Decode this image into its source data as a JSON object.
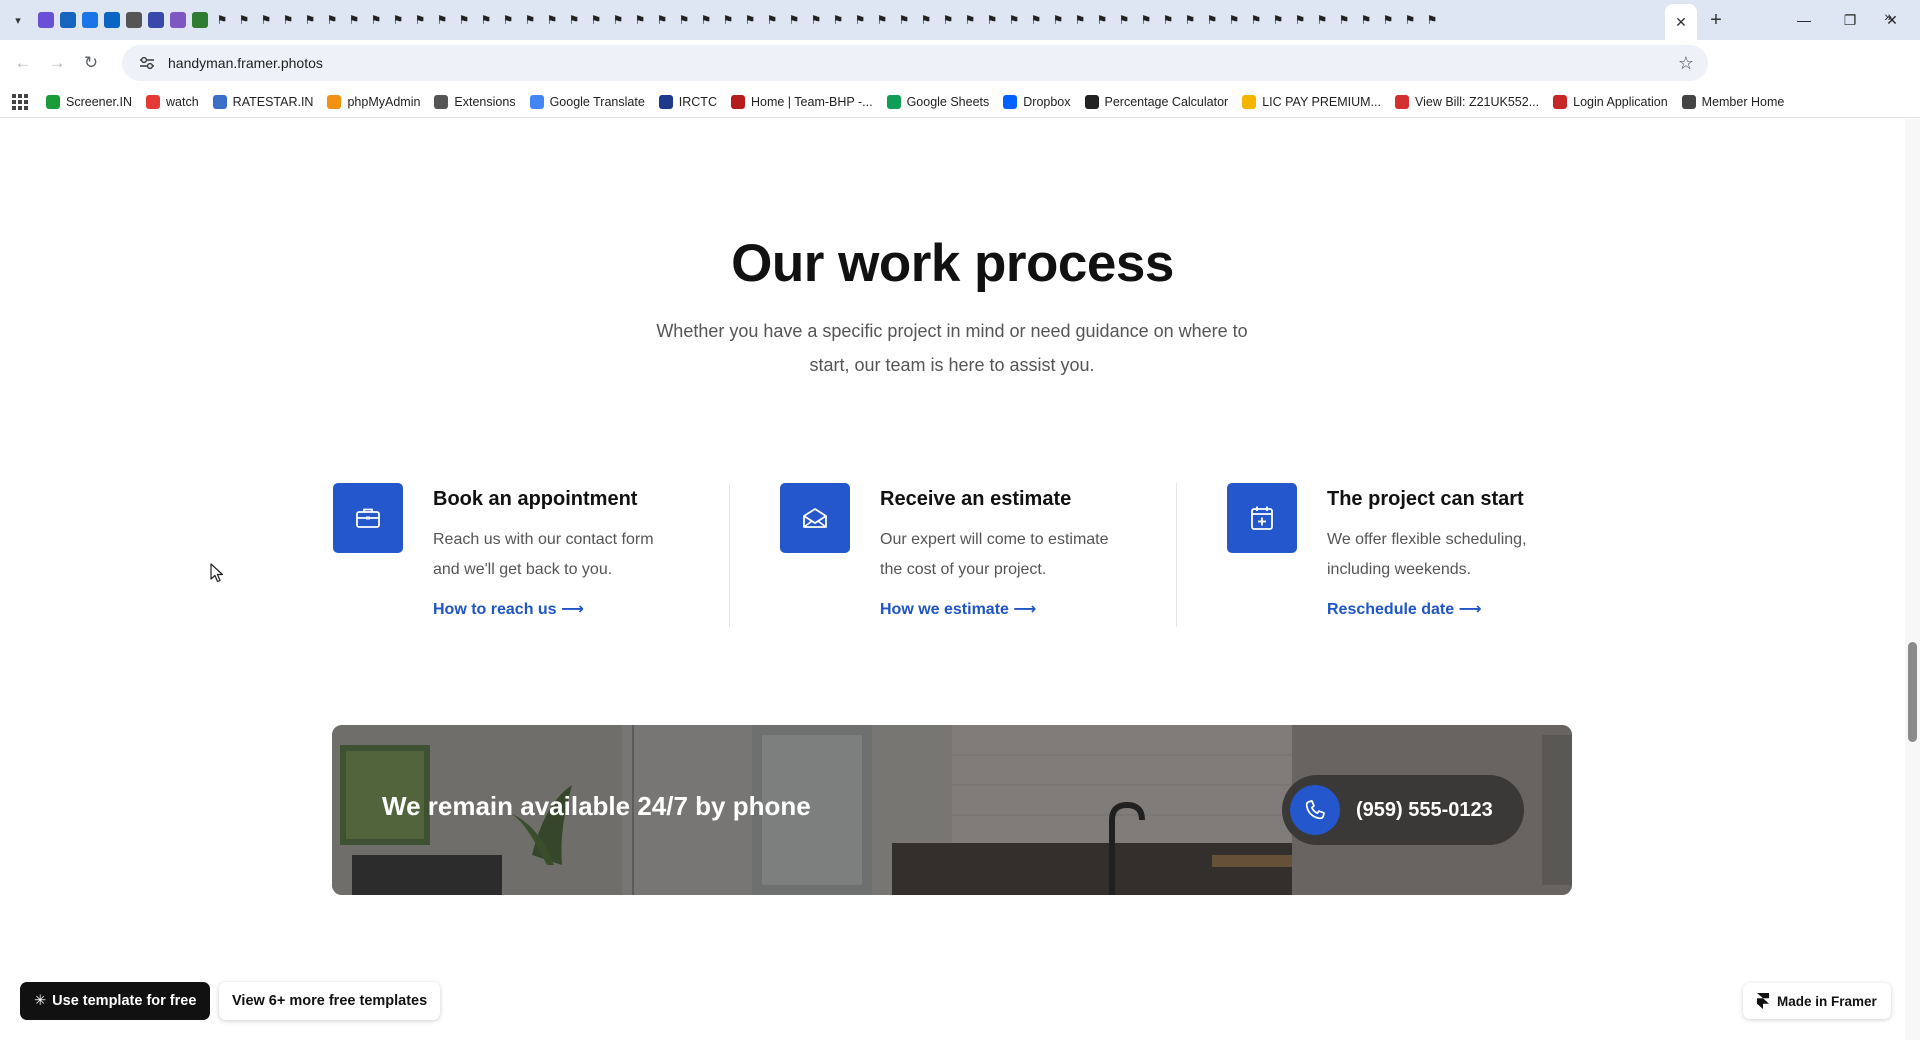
{
  "browser": {
    "url": "handyman.framer.photos",
    "bookmarks": [
      {
        "label": "Screener.IN",
        "color": "#1a9c3b",
        "icon": "bar-chart-icon"
      },
      {
        "label": "watch",
        "color": "#e53935",
        "icon": "youtube-icon"
      },
      {
        "label": "RATESTAR.IN",
        "color": "#3b6fc7",
        "icon": "star-icon"
      },
      {
        "label": "phpMyAdmin",
        "color": "#f29111",
        "icon": "phpmyadmin-icon"
      },
      {
        "label": "Extensions",
        "color": "#555555",
        "icon": "puzzle-icon"
      },
      {
        "label": "Google Translate",
        "color": "#4285f4",
        "icon": "translate-icon"
      },
      {
        "label": "IRCTC",
        "color": "#1e3a8a",
        "icon": "irctc-icon"
      },
      {
        "label": "Home | Team-BHP -...",
        "color": "#b71c1c",
        "icon": "teambhp-icon"
      },
      {
        "label": "Google Sheets",
        "color": "#0f9d58",
        "icon": "sheets-icon"
      },
      {
        "label": "Dropbox",
        "color": "#0061fe",
        "icon": "dropbox-icon"
      },
      {
        "label": "Percentage Calculator",
        "color": "#222222",
        "icon": "calculator-icon"
      },
      {
        "label": "LIC PAY PREMIUM...",
        "color": "#f5b400",
        "icon": "lic-icon"
      },
      {
        "label": "View Bill: Z21UK552...",
        "color": "#d32f2f",
        "icon": "bill-icon"
      },
      {
        "label": "Login Application",
        "color": "#c62828",
        "icon": "login-icon"
      },
      {
        "label": "Member Home",
        "color": "#444444",
        "icon": "globe-icon"
      }
    ]
  },
  "process": {
    "title": "Our work process",
    "subtitle": "Whether you have a specific project in mind or need guidance on where to start, our team is here to assist you.",
    "steps": [
      {
        "title": "Book an appointment",
        "desc": "Reach us with our contact form and we'll get back to you.",
        "link": "How to reach us ⟶",
        "icon": "briefcase-icon"
      },
      {
        "title": "Receive an estimate",
        "desc": "Our expert will come to estimate the cost of your project.",
        "link": "How we estimate ⟶",
        "icon": "envelope-icon"
      },
      {
        "title": "The project can start",
        "desc": "We offer flexible scheduling, including weekends.",
        "link": "Reschedule date ⟶",
        "icon": "calendar-plus-icon"
      }
    ]
  },
  "banner": {
    "title": "We remain available 24/7 by phone",
    "phone": "(959) 555-0123"
  },
  "footer_buttons": {
    "use_template": "Use template for free",
    "more_templates": "View 6+ more free templates",
    "made_in": "Made in Framer"
  },
  "colors": {
    "accent": "#2456cc",
    "link": "#1f55c6"
  }
}
